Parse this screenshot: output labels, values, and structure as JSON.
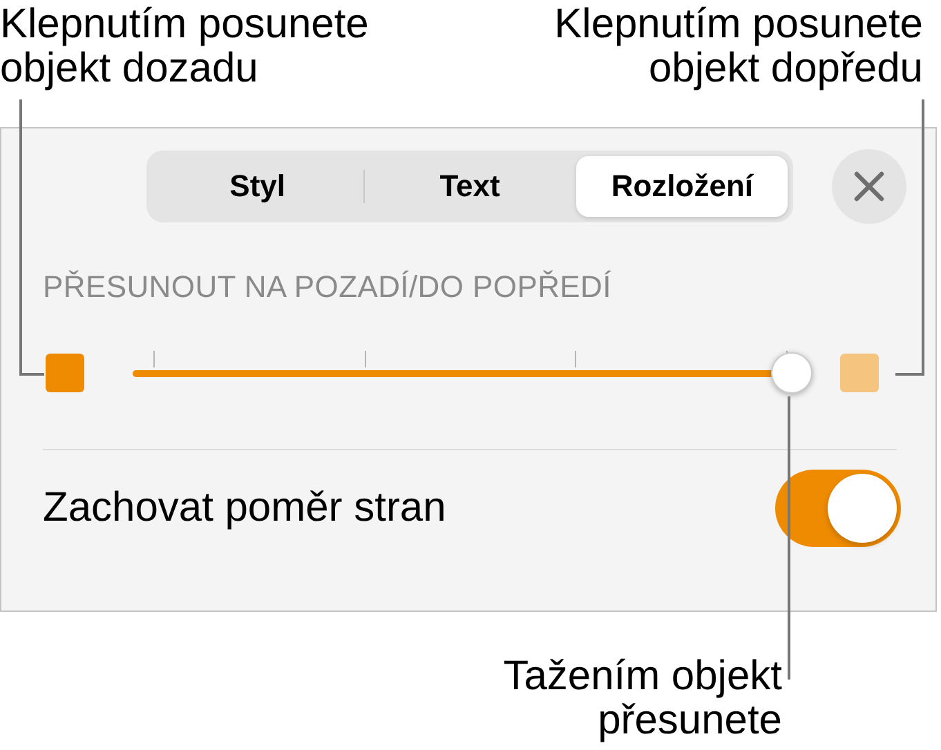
{
  "callouts": [
    {
      "text": "Klepnutím posunete\nobjekt dozadu"
    },
    {
      "text": "Klepnutím posunete\nobjekt dopředu"
    },
    {
      "text": "Tažením objekt\npřesunete"
    }
  ],
  "tabs": [
    {
      "label": "Styl",
      "selected": false
    },
    {
      "label": "Text",
      "selected": false
    },
    {
      "label": "Rozložení",
      "selected": true
    }
  ],
  "section_header": "PŘESUNOUT NA POZADÍ/DO POPŘEDÍ",
  "slider": {
    "level": 1
  },
  "toggle": {
    "label": "Zachovat poměr stran",
    "on": true
  }
}
